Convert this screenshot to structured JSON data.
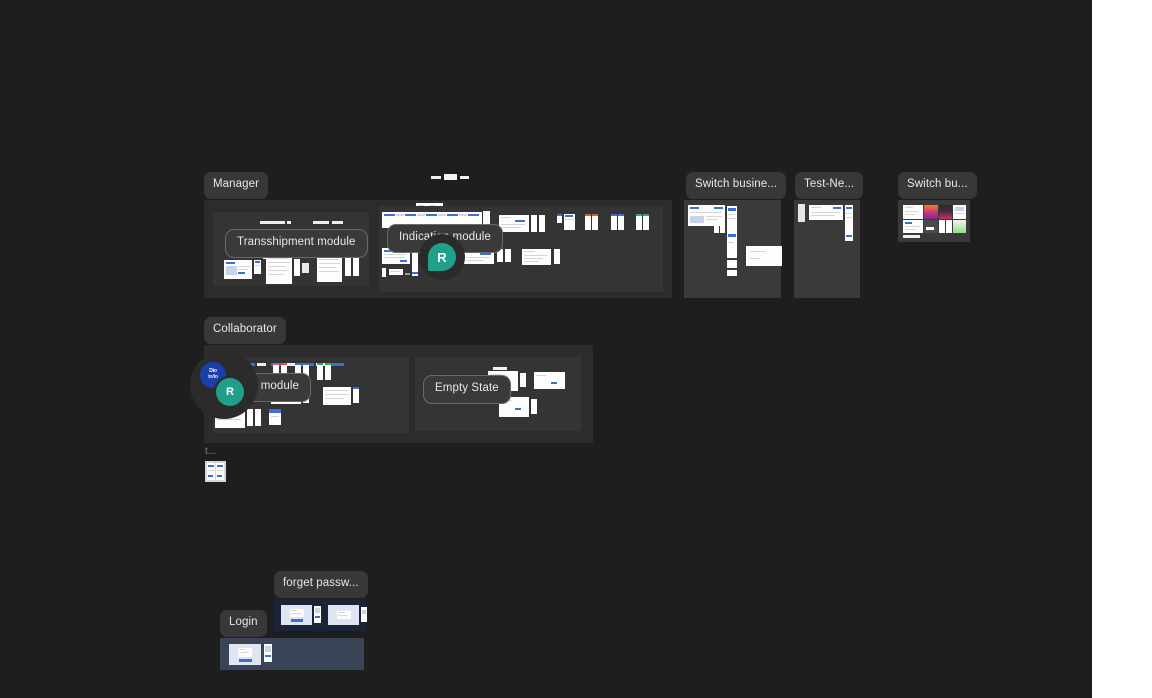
{
  "app": {
    "canvas_background": "#1e1e1e",
    "gutter_background": "#ffffff"
  },
  "frames": {
    "manager": {
      "label": "Manager",
      "children": [
        {
          "label": "Transshipment module"
        },
        {
          "label": "Indication module"
        }
      ]
    },
    "switch_business_1": {
      "label": "Switch busine..."
    },
    "test_new": {
      "label": "Test-Ne..."
    },
    "switch_business_2": {
      "label": "Switch bu..."
    },
    "collaborator": {
      "label": "Collaborator",
      "children": [
        {
          "label": "ation module"
        },
        {
          "label": "Empty State"
        }
      ]
    },
    "tiny_frame": {
      "label": "t..."
    },
    "forget_password": {
      "label": "forget passw..."
    },
    "login": {
      "label": "Login"
    }
  },
  "collaborators": [
    {
      "name": "collaborator-avatar-logo",
      "initial": "Dio",
      "sub": "to/to",
      "color": "#1b3fa8"
    },
    {
      "name": "collaborator-cursor-r",
      "initial": "R",
      "color": "#20a08a"
    }
  ],
  "cursors": [
    {
      "initial": "R",
      "color": "#20a08a"
    }
  ]
}
